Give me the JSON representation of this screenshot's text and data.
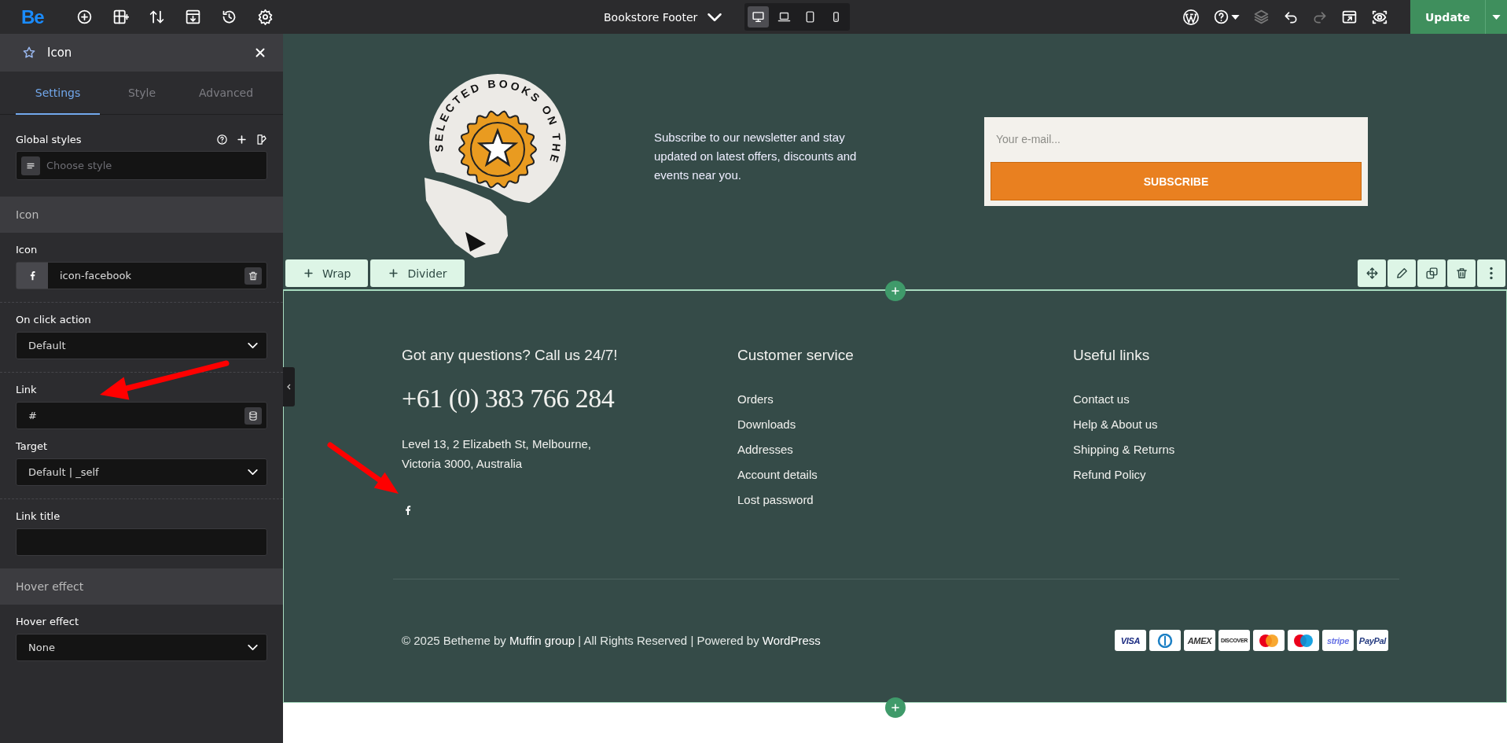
{
  "topbar": {
    "logo": "Be",
    "document_title": "Bookstore Footer",
    "devices": [
      {
        "kind": "desktop",
        "selected": true
      },
      {
        "kind": "laptop",
        "selected": false
      },
      {
        "kind": "tablet",
        "selected": false
      },
      {
        "kind": "mobile",
        "selected": false
      }
    ],
    "update_button": "Update"
  },
  "panel": {
    "title": "Icon",
    "tabs": [
      {
        "label": "Settings",
        "selected": true
      },
      {
        "label": "Style",
        "selected": false
      },
      {
        "label": "Advanced",
        "selected": false
      }
    ],
    "global_styles": {
      "label": "Global styles",
      "placeholder": "Choose style"
    },
    "sections": [
      {
        "title": "Icon",
        "fields": [
          {
            "kind": "icon",
            "label": "Icon",
            "value": "icon-facebook"
          },
          {
            "kind": "select",
            "label": "On click action",
            "value": "Default"
          },
          {
            "kind": "link",
            "label": "Link",
            "value": "#"
          },
          {
            "kind": "select",
            "label": "Target",
            "value": "Default | _self"
          },
          {
            "kind": "text",
            "label": "Link title"
          }
        ]
      },
      {
        "title": "Hover effect",
        "fields": [
          {
            "kind": "select",
            "label": "Hover effect",
            "value": "None"
          }
        ]
      }
    ]
  },
  "canvas": {
    "newsletter": {
      "badge_text": "SELECTED BOOKS ON THE",
      "text": "Subscribe to our newsletter and stay updated on latest offers, discounts and events near you.",
      "email_placeholder": "Your e-mail...",
      "subscribe_button": "SUBSCRIBE"
    },
    "editor_buttons": [
      "Wrap",
      "Divider"
    ],
    "footer": {
      "contact": {
        "heading": "Got any questions? Call us 24/7!",
        "phone": "+61 (0) 383 766 284",
        "address": [
          "Level 13, 2 Elizabeth St, Melbourne,",
          "Victoria 3000, Australia"
        ]
      },
      "columns": [
        {
          "heading": "Customer service",
          "links": [
            "Orders",
            "Downloads",
            "Addresses",
            "Account details",
            "Lost password"
          ]
        },
        {
          "heading": "Useful links",
          "links": [
            "Contact us",
            "Help & About us",
            "Shipping & Returns",
            "Refund Policy"
          ]
        }
      ],
      "copyright": [
        {
          "kind": "plain",
          "text": "© 2025 Betheme by "
        },
        {
          "kind": "link",
          "text": "Muffin group"
        },
        {
          "kind": "plain",
          "text": " | All Rights Reserved | Powered by "
        },
        {
          "kind": "link",
          "text": "WordPress"
        }
      ],
      "payments": [
        {
          "kind": "wordmark",
          "label": "VISA",
          "color": "#1a2a80"
        },
        {
          "kind": "diners"
        },
        {
          "kind": "wordmark",
          "label": "AMEX",
          "color": "#333333"
        },
        {
          "kind": "wordmark",
          "label": "DISCOVER",
          "color": "#222222"
        },
        {
          "kind": "mastercard"
        },
        {
          "kind": "maestro"
        },
        {
          "kind": "wordmark",
          "label": "stripe",
          "color": "#6772e5"
        },
        {
          "kind": "wordmark",
          "label": "PayPal",
          "color": "#253b80"
        }
      ]
    }
  },
  "annotations": [
    {
      "kind": "arrow"
    },
    {
      "kind": "arrow"
    }
  ]
}
